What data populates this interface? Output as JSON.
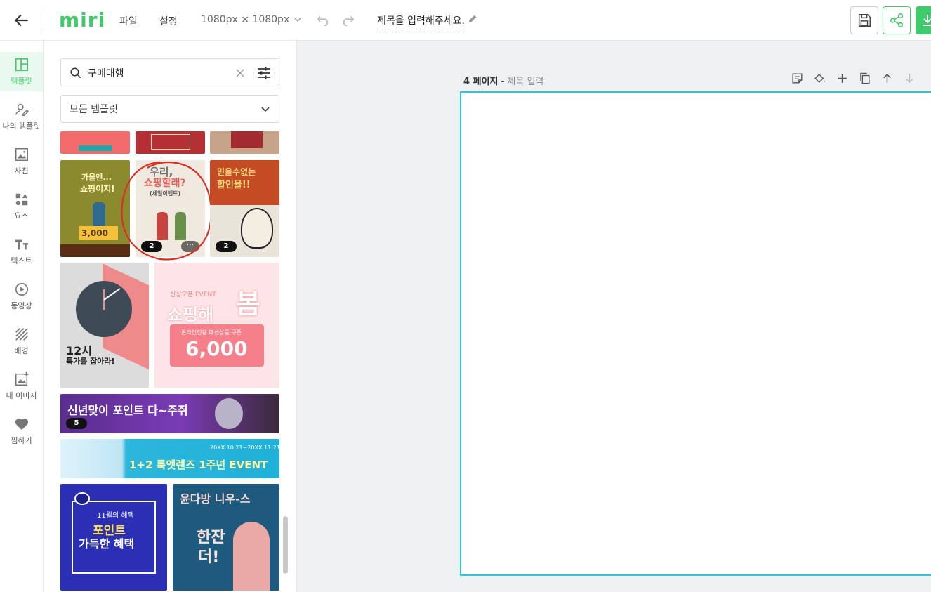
{
  "topbar": {
    "logo": "miri",
    "menu": [
      "파일",
      "설정"
    ],
    "canvas_size": "1080px × 1080px",
    "doc_title": "제목을 입력해주세요."
  },
  "colors": {
    "accent": "#3fca6b",
    "canvas_border": "#2cc7cf"
  },
  "sidebar": {
    "items": [
      {
        "label": "템플릿",
        "icon": "layout-icon",
        "active": true
      },
      {
        "label": "나의 템플릿",
        "icon": "user-edit-icon"
      },
      {
        "label": "사진",
        "icon": "image-icon"
      },
      {
        "label": "요소",
        "icon": "shapes-icon"
      },
      {
        "label": "텍스트",
        "icon": "text-icon"
      },
      {
        "label": "동영상",
        "icon": "play-icon"
      },
      {
        "label": "배경",
        "icon": "pattern-icon"
      },
      {
        "label": "내 이미지",
        "icon": "image-add-icon"
      },
      {
        "label": "찜하기",
        "icon": "heart-icon"
      }
    ]
  },
  "panel": {
    "search": {
      "value": "구매대행"
    },
    "category": "모든 템플릿",
    "templates": {
      "t1": {
        "line1": "가을엔...",
        "line2": "쇼핑이지!",
        "price": "3,000"
      },
      "t2": {
        "line1": "우리,",
        "line2": "쇼핑할래?",
        "sub": "(세일이벤트)",
        "badge": "2",
        "more": "···"
      },
      "t3": {
        "line1": "믿을수없는",
        "line2": "할인율!!",
        "badge": "2"
      },
      "t4": {
        "line1": "12시",
        "line2": "특가를 잡아라!"
      },
      "t5": {
        "line1": "신상오픈 EVENT",
        "line2": "쇼핑해",
        "line3": "봄",
        "sub": "온라인전용 패션상품 쿠폰",
        "price": "6,000"
      },
      "t6": {
        "line1": "신년맞이 포인트 다~주쥐",
        "badge": "5"
      },
      "t7": {
        "line1": "1+2 룩엣렌즈 1주년 EVENT",
        "date": "20XX.10.21~20XX.11.21"
      },
      "t8": {
        "line1": "11월의 혜택",
        "line2": "포인트",
        "line3": "가득한 혜택"
      },
      "t9": {
        "line1": "윤다방 니우-스",
        "line2": "한잔",
        "line3": "더!"
      }
    }
  },
  "workspace": {
    "page_number": "4 페이지",
    "page_title_placeholder": "제목 입력"
  }
}
